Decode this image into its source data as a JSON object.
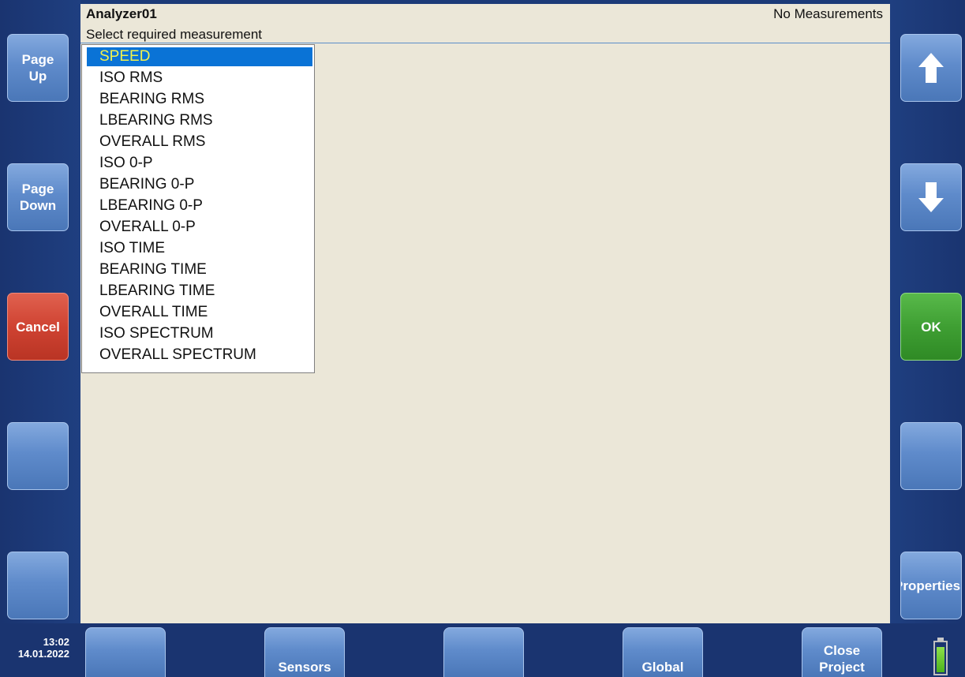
{
  "header": {
    "title": "Analyzer01",
    "status": "No Measurements",
    "subtitle": "Select required measurement"
  },
  "measurement_list": {
    "selected_index": 0,
    "items": [
      "SPEED",
      "ISO RMS",
      "BEARING RMS",
      "LBEARING RMS",
      "OVERALL RMS",
      "ISO 0-P",
      "BEARING 0-P",
      "LBEARING 0-P",
      "OVERALL 0-P",
      "ISO TIME",
      "BEARING TIME",
      "LBEARING TIME",
      "OVERALL TIME",
      "ISO SPECTRUM",
      "OVERALL SPECTRUM"
    ]
  },
  "left_buttons": {
    "page_up": "Page\nUp",
    "page_down": "Page\nDown",
    "cancel": "Cancel",
    "blank1": "",
    "blank2": ""
  },
  "right_buttons": {
    "up_icon": "arrow-up-icon",
    "down_icon": "arrow-down-icon",
    "ok": "OK",
    "blank": "",
    "properties": "Properties"
  },
  "bottom_buttons": {
    "b1": "",
    "sensors": "Sensors",
    "b3": "",
    "global": "Global",
    "close_project": "Close\nProject"
  },
  "clock": {
    "time": "13:02",
    "date": "14.01.2022"
  },
  "battery": {
    "level": 0.9
  },
  "colors": {
    "frame": "#1a3470",
    "content_bg": "#ebe7d8",
    "selection_bg": "#0a73d6",
    "selection_text": "#f2f24d",
    "cancel": "#cf4332",
    "ok": "#3f9f33"
  }
}
